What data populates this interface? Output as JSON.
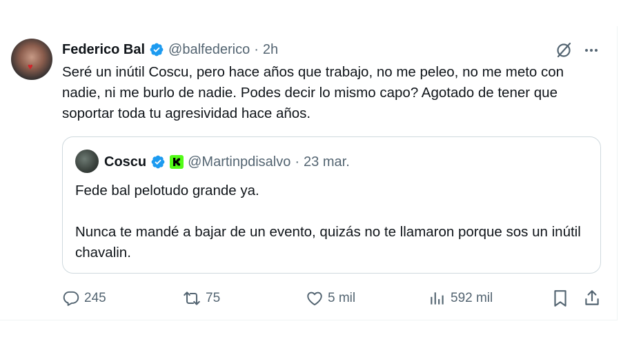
{
  "tweet": {
    "author_name": "Federico Bal",
    "handle": "@balfederico",
    "separator": "·",
    "time": "2h",
    "text": "Seré un inútil Coscu, pero hace años que trabajo, no me peleo, no me meto con nadie, ni me burlo de nadie. Podes decir lo mismo capo? Agotado de tener que soportar toda tu agresividad hace años."
  },
  "quote": {
    "author_name": "Coscu",
    "handle": "@Martinpdisalvo",
    "separator": "·",
    "date": "23 mar.",
    "paragraph_1": "Fede bal pelotudo grande ya.",
    "paragraph_2": "Nunca te mandé a bajar de un evento, quizás no te llamaron porque sos un inútil chavalin."
  },
  "actions": {
    "replies": "245",
    "retweets": "75",
    "likes": "5 mil",
    "views": "592 mil"
  },
  "icons": {
    "verified": "verified-badge-icon",
    "grok": "grok-icon",
    "more": "more-icon",
    "reply": "reply-icon",
    "retweet": "retweet-icon",
    "like": "heart-icon",
    "views": "views-icon",
    "bookmark": "bookmark-icon",
    "share": "share-icon",
    "kick": "kick-badge-icon"
  },
  "colors": {
    "verified_blue": "#1d9bf0",
    "text": "#0f1419",
    "secondary": "#536471",
    "border": "#cfd9de",
    "kick_green": "#53fc18"
  }
}
